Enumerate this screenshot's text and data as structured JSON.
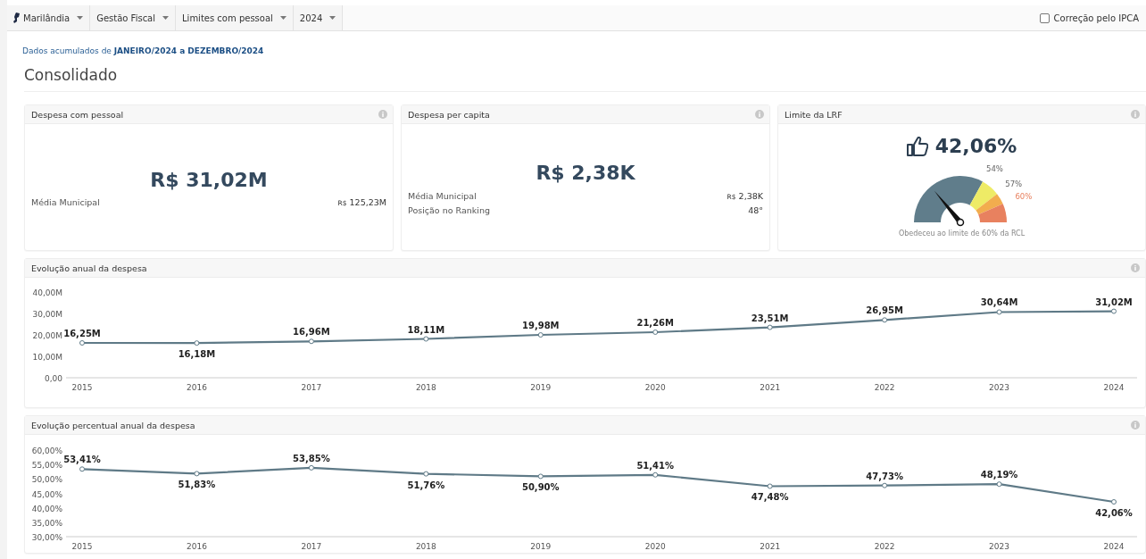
{
  "nav": {
    "items": [
      {
        "label": "Marilândia",
        "icon": true
      },
      {
        "label": "Gestão Fiscal",
        "icon": false
      },
      {
        "label": "Limites com pessoal",
        "icon": false
      },
      {
        "label": "2024",
        "icon": false
      }
    ],
    "ipca": {
      "label": "Correção pelo IPCA",
      "checked": false
    }
  },
  "period": "Dados acumulados de **JANEIRO/2024 a DEZEMBRO/2024**",
  "section_title": "Consolidado",
  "cards": [
    {
      "kind": "value",
      "title": "Despesa com pessoal",
      "value": "R$ 31,02M",
      "rows": [
        {
          "label": "Média Municipal",
          "currency": "R$",
          "value": "125,23M"
        }
      ]
    },
    {
      "kind": "value",
      "title": "Despesa per capita",
      "value": "R$ 2,38K",
      "rows": [
        {
          "label": "Média Municipal",
          "currency": "R$",
          "value": "2,38K"
        },
        {
          "label": "Posição no Ranking",
          "value": "48°"
        }
      ]
    },
    {
      "kind": "gauge",
      "title": "Limite da LRF",
      "value": "42,06%",
      "bands": [
        {
          "color": "#607d8b"
        },
        {
          "color": "#eeeb66"
        },
        {
          "color": "#f2ad4e"
        },
        {
          "color": "#e8815f"
        }
      ],
      "thresholds": [
        {
          "label": "54%",
          "alert": false
        },
        {
          "label": "57%",
          "alert": false
        },
        {
          "label": "60%",
          "alert": true
        }
      ],
      "caption": "Obedeceu ao limite de 60% da RCL"
    }
  ],
  "charts": [
    {
      "title": "Evolução anual da despesa",
      "chart_data": {
        "type": "line",
        "categories": [
          "2015",
          "2016",
          "2017",
          "2018",
          "2019",
          "2020",
          "2021",
          "2022",
          "2023",
          "2024"
        ],
        "series": [
          {
            "color": "#5f7a87",
            "marker": "circle",
            "values": [
              16.25,
              16.18,
              16.96,
              18.11,
              19.98,
              21.26,
              23.51,
              26.95,
              30.64,
              31.02
            ]
          }
        ],
        "ylim": [
          0,
          40
        ],
        "yticks": [
          {
            "value": 0,
            "label": "0,00"
          },
          {
            "value": 10,
            "label": "10,00M"
          },
          {
            "value": 20,
            "label": "20,00M"
          },
          {
            "value": 30,
            "label": "30,00M"
          },
          {
            "value": 40,
            "label": "40,00M"
          }
        ],
        "value_labels": [
          "16,25M",
          "16,18M",
          "16,96M",
          "18,11M",
          "19,98M",
          "21,26M",
          "23,51M",
          "26,95M",
          "30,64M",
          "31,02M"
        ]
      }
    },
    {
      "title": "Evolução percentual anual da despesa",
      "chart_data": {
        "type": "line",
        "categories": [
          "2015",
          "2016",
          "2017",
          "2018",
          "2019",
          "2020",
          "2021",
          "2022",
          "2023",
          "2024"
        ],
        "series": [
          {
            "color": "#5f7a87",
            "marker": "circle",
            "values": [
              53.41,
              51.83,
              53.85,
              51.76,
              50.9,
              51.41,
              47.48,
              47.73,
              48.19,
              42.06
            ]
          }
        ],
        "ylim": [
          30,
          60
        ],
        "yticks": [
          {
            "value": 30,
            "label": "30,00%"
          },
          {
            "value": 35,
            "label": "35,00%"
          },
          {
            "value": 40,
            "label": "40,00%"
          },
          {
            "value": 45,
            "label": "45,00%"
          },
          {
            "value": 50,
            "label": "50,00%"
          },
          {
            "value": 55,
            "label": "55,00%"
          },
          {
            "value": 60,
            "label": "60,00%"
          }
        ],
        "value_labels": [
          "53,41%",
          "51,83%",
          "53,85%",
          "51,76%",
          "50,90%",
          "51,41%",
          "47,48%",
          "47,73%",
          "48,19%",
          "42,06%"
        ]
      }
    }
  ]
}
